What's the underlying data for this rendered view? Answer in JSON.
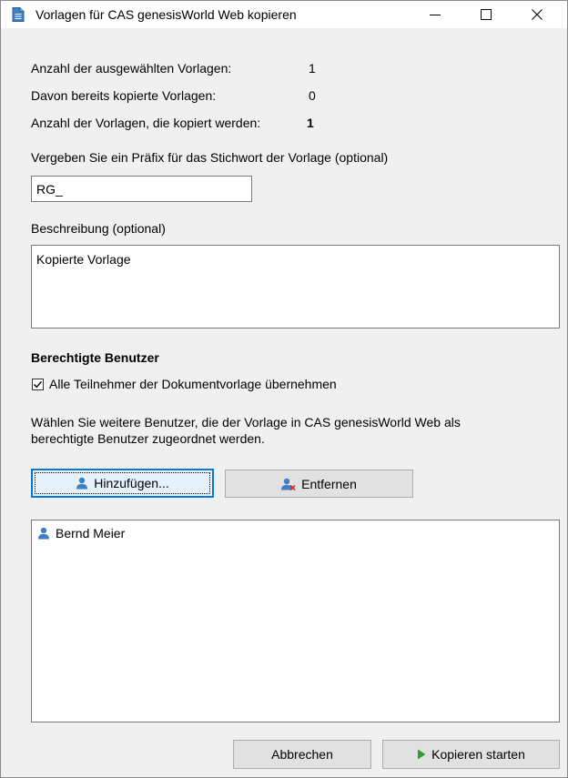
{
  "window": {
    "title": "Vorlagen für CAS genesisWorld Web kopieren",
    "icon": "document-icon"
  },
  "summary": {
    "selected_label": "Anzahl der ausgewählten Vorlagen:",
    "selected_value": "1",
    "copied_label": "Davon bereits kopierte Vorlagen:",
    "copied_value": "0",
    "tocopy_label": "Anzahl der Vorlagen, die kopiert werden:",
    "tocopy_value": "1"
  },
  "prefix": {
    "label": "Vergeben Sie ein Präfix für das Stichwort der Vorlage (optional)",
    "value": "RG_"
  },
  "description": {
    "label": "Beschreibung (optional)",
    "value": "Kopierte Vorlage"
  },
  "users": {
    "heading": "Berechtigte Benutzer",
    "checkbox_label": "Alle Teilnehmer der Dokumentvorlage übernehmen",
    "checkbox_checked": true,
    "hint_line1": "Wählen Sie weitere Benutzer, die der Vorlage in CAS genesisWorld Web als",
    "hint_line2": "berechtigte Benutzer zugeordnet werden.",
    "add_label": "Hinzufügen...",
    "remove_label": "Entfernen",
    "list": [
      {
        "name": "Bernd Meier",
        "icon": "user-icon"
      }
    ]
  },
  "footer": {
    "cancel_label": "Abbrechen",
    "start_label": "Kopieren starten"
  },
  "colors": {
    "accent": "#0078d7",
    "user_icon": "#3c7fc4",
    "remove_x": "#d32f2f",
    "play": "#2e9e2e"
  }
}
